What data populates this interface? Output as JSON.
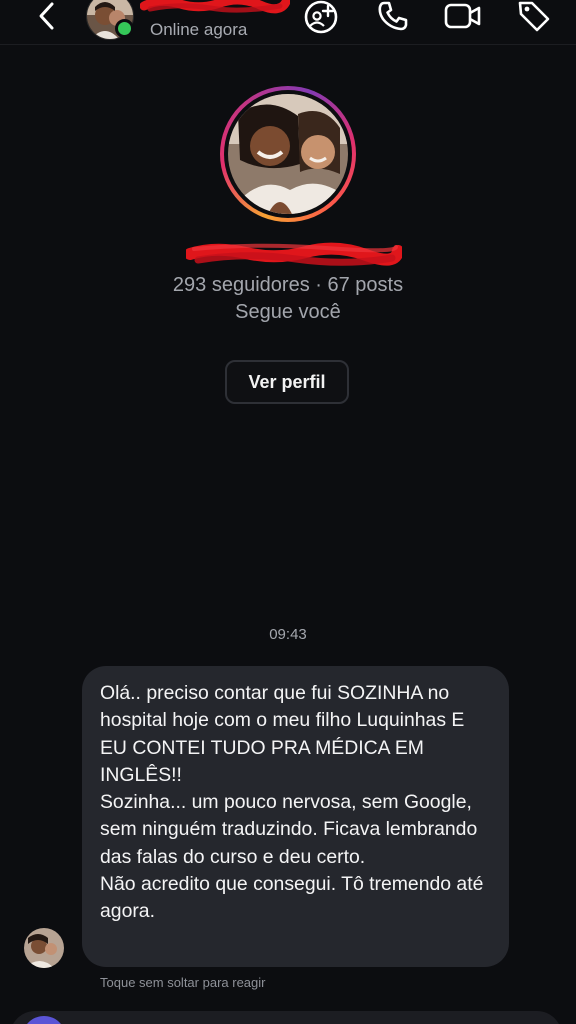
{
  "header": {
    "status": "Online agora",
    "back_icon": "chevron-left-icon",
    "icons": [
      "add-friend-icon",
      "phone-icon",
      "video-camera-icon",
      "tag-icon"
    ]
  },
  "profile": {
    "stats": "293 seguidores · 67 posts",
    "follows_you": "Segue você",
    "view_profile_label": "Ver perfil"
  },
  "chat": {
    "timestamp": "09:43",
    "message": {
      "line1": "Olá.. preciso contar que fui SOZINHA no hospital hoje com o meu filho Luquinhas E EU CONTEI TUDO PRA MÉDICA EM INGLÊS!!",
      "line2": "Sozinha... um pouco nervosa, sem Google, sem ninguém traduzindo. Ficava lembrando das falas do curso e deu certo.",
      "line3": "Não acredito que consegui. Tô tremendo até agora."
    },
    "hint": "Toque sem soltar para reagir"
  },
  "colors": {
    "background": "#0c0d10",
    "bubble": "#25272d",
    "online": "#35c759",
    "redaction": "#e0161b",
    "composer_button": "#5a54d6"
  }
}
